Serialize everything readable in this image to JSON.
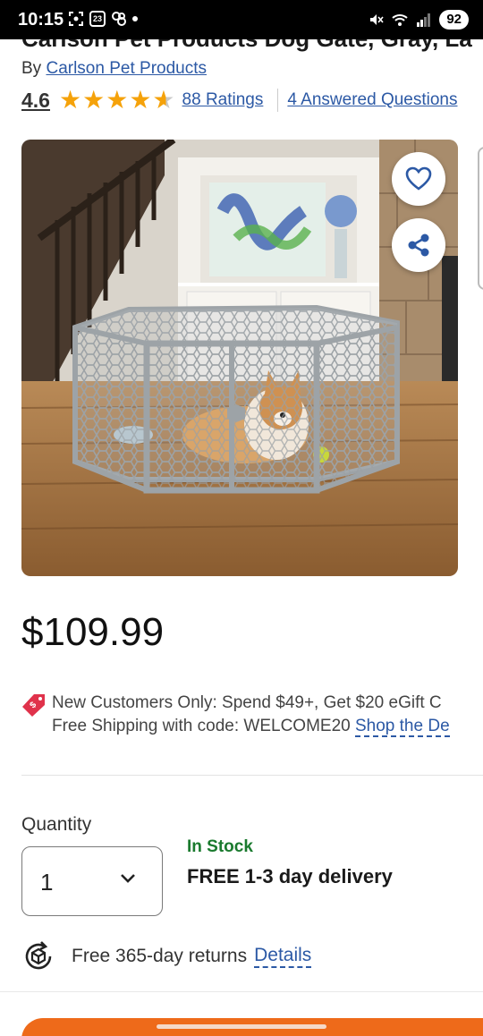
{
  "status_bar": {
    "time": "10:15",
    "calendar_day": "23",
    "battery": "92"
  },
  "product": {
    "title": "Carlson Pet Products Dog Gate, Gray, La",
    "by_prefix": "By",
    "brand": "Carlson Pet Products",
    "rating": "4.6",
    "stars_filled": 4.6,
    "ratings_link": "88 Ratings",
    "answered_link": "4 Answered Questions",
    "price": "$109.99"
  },
  "image": {
    "favorite_icon": "heart-icon",
    "share_icon": "share-icon"
  },
  "promo": {
    "line1": "New Customers Only: Spend $49+, Get $20 eGift C",
    "line2_text": "Free Shipping with code: WELCOME20",
    "line2_link": "Shop the De"
  },
  "purchase": {
    "quantity_label": "Quantity",
    "quantity_value": "1",
    "stock_status": "In Stock",
    "delivery": "FREE 1-3 day delivery"
  },
  "returns": {
    "text": "Free 365-day returns",
    "link": "Details"
  },
  "colors": {
    "link": "#2c59a5",
    "star": "#f5a20a",
    "in_stock": "#1a7a2e",
    "cta": "#ee6a1a"
  }
}
